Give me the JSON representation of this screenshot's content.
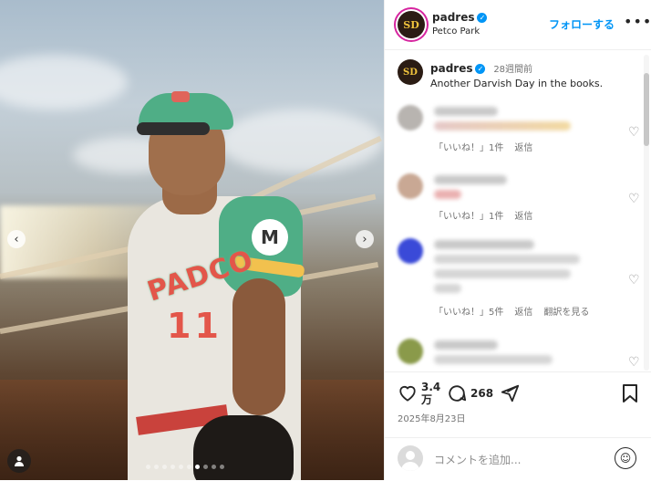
{
  "post": {
    "username": "padres",
    "location": "Petco Park",
    "follow_label": "フォローする",
    "more_label": "•••",
    "avatar_letter": "SD"
  },
  "photo": {
    "jersey_text": "PADCO",
    "jersey_number": "11",
    "patch_letter": "M",
    "prev_arrow": "‹",
    "next_arrow": "›",
    "slide_count": 10,
    "active_slide": 6,
    "user_tag_icon": "person-icon"
  },
  "caption": {
    "username": "padres",
    "time_ago": "28週間前",
    "text": "Another Darvish Day in the books."
  },
  "comments": [
    {
      "likes": "「いいね！」1件",
      "reply": "返信",
      "translate": ""
    },
    {
      "likes": "「いいね！」1件",
      "reply": "返信",
      "translate": ""
    },
    {
      "likes": "「いいね！」5件",
      "reply": "返信",
      "translate": "翻訳を見る"
    }
  ],
  "actions": {
    "like_count": "3.4",
    "like_count_unit": "万",
    "comment_count": "268",
    "date": "2025年8月23日"
  },
  "add_comment": {
    "placeholder": "コメントを追加..."
  },
  "colors": {
    "accent": "#0095f6",
    "brand_gold": "#f0c33c",
    "brand_brown": "#2b1c14"
  }
}
